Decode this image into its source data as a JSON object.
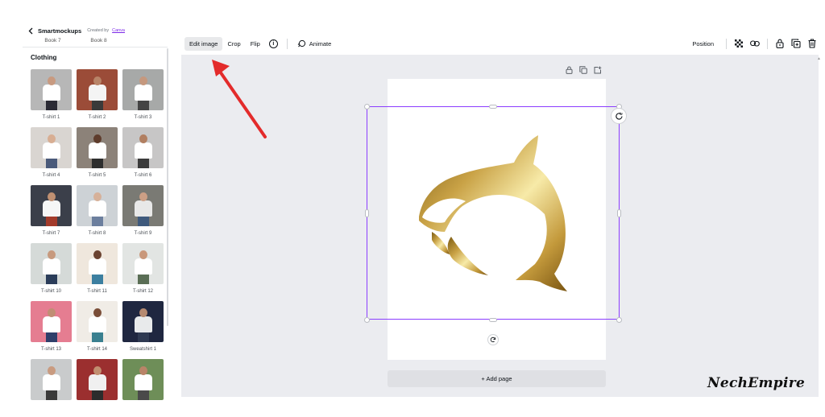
{
  "panel": {
    "app_title": "Smartmockups",
    "created_by": "Created by",
    "canva_link": "Canva",
    "books": [
      "Book 7",
      "Book 8"
    ],
    "section_title": "Clothing",
    "items": [
      {
        "label": "T-shirt 1",
        "bg": "#b7b7b7",
        "shirt": "#ffffff",
        "skin": "#c89a80",
        "pants": "#2b2b35"
      },
      {
        "label": "T-shirt 2",
        "bg": "#9b4c38",
        "shirt": "#f4f4f4",
        "skin": "#b88468",
        "pants": "#3a3a3a"
      },
      {
        "label": "T-shirt 3",
        "bg": "#a7a9a8",
        "shirt": "#ffffff",
        "skin": "#c5987e",
        "pants": "#444444"
      },
      {
        "label": "T-shirt 4",
        "bg": "#d9d5d1",
        "shirt": "#ffffff",
        "skin": "#d8ae93",
        "pants": "#4a5a7a"
      },
      {
        "label": "T-shirt 5",
        "bg": "#8c8279",
        "shirt": "#ffffff",
        "skin": "#5e3c2c",
        "pants": "#2e2e2e"
      },
      {
        "label": "T-shirt 6",
        "bg": "#c7c6c6",
        "shirt": "#ffffff",
        "skin": "#b17f61",
        "pants": "#3b3b3b"
      },
      {
        "label": "T-shirt 7",
        "bg": "#3b3f4a",
        "shirt": "#f6f6f6",
        "skin": "#c09072",
        "pants": "#a33b2b"
      },
      {
        "label": "T-shirt 8",
        "bg": "#cdd2d6",
        "shirt": "#ffffff",
        "skin": "#d6b19a",
        "pants": "#6c7f9e"
      },
      {
        "label": "T-shirt 9",
        "bg": "#7a7a74",
        "shirt": "#e8e8e8",
        "skin": "#cc9f85",
        "pants": "#3f5a7d"
      },
      {
        "label": "T-shirt 10",
        "bg": "#d5dad8",
        "shirt": "#ffffff",
        "skin": "#c79a7e",
        "pants": "#2b3d5a"
      },
      {
        "label": "T-shirt 11",
        "bg": "#efe7dd",
        "shirt": "#ffffff",
        "skin": "#6b4331",
        "pants": "#3c7fa0"
      },
      {
        "label": "T-shirt 12",
        "bg": "#e2e5e3",
        "shirt": "#ffffff",
        "skin": "#c9987b",
        "pants": "#5a6e55"
      },
      {
        "label": "T-shirt 13",
        "bg": "#e57d91",
        "shirt": "#ffffff",
        "skin": "#c08e74",
        "pants": "#2f3f6a"
      },
      {
        "label": "T-shirt 14",
        "bg": "#f0ece6",
        "shirt": "#ffffff",
        "skin": "#7a4e38",
        "pants": "#3a8090"
      },
      {
        "label": "Sweatshirt 1",
        "bg": "#1f2740",
        "shirt": "#e8eaeb",
        "skin": "#b58a70",
        "pants": "#2f3a52"
      },
      {
        "label": "",
        "bg": "#c9cbcc",
        "shirt": "#ffffff",
        "skin": "#c99b80",
        "pants": "#3a3a3a"
      },
      {
        "label": "",
        "bg": "#9b2f2f",
        "shirt": "#f0f0f0",
        "skin": "#c18e70",
        "pants": "#2c2c2c"
      },
      {
        "label": "",
        "bg": "#6e8e58",
        "shirt": "#ffffff",
        "skin": "#b98468",
        "pants": "#4a4a4a"
      }
    ]
  },
  "toolbar": {
    "edit_image": "Edit image",
    "crop": "Crop",
    "flip": "Flip",
    "info": "i",
    "animate": "Animate",
    "position": "Position"
  },
  "canvas": {
    "add_page": "+ Add page",
    "selection_color": "#8b3dff",
    "background": "#ebecf0"
  },
  "watermark": "NechEmpire"
}
